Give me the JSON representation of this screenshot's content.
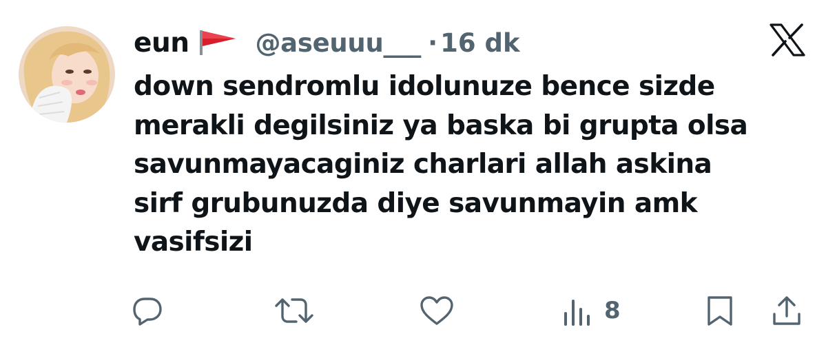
{
  "tweet": {
    "display_name": "eun",
    "flag_icon": "red-flag-icon",
    "handle": "@aseuuu___",
    "separator": "·",
    "time": "16 dk",
    "text": "down sendromlu idolunuze bence sizde\nmerakli degilsiniz ya baska bi grupta olsa\nsavunmayacaginiz charlari allah askina\nsirf grubunuzda diye savunmayin amk\nvasifsizi",
    "views": "8"
  },
  "icons": {
    "logo": "x-logo-icon",
    "reply": "reply-icon",
    "retweet": "retweet-icon",
    "like": "heart-icon",
    "views": "views-chart-icon",
    "bookmark": "bookmark-icon",
    "share": "share-icon"
  },
  "colors": {
    "text_primary": "#0f1419",
    "text_secondary": "#536471",
    "flag_red": "#d81e2c",
    "background": "#ffffff"
  }
}
